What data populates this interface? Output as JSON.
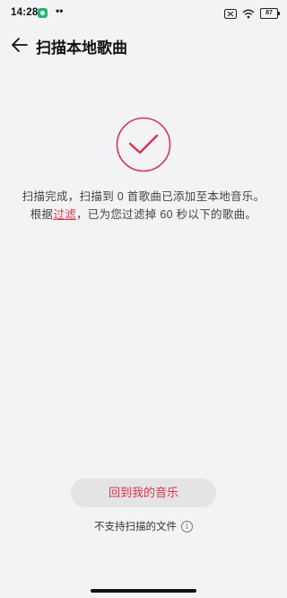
{
  "status_bar": {
    "time": "14:28",
    "dots": "••",
    "battery": "87",
    "icons": [
      "app-notification-icon",
      "sim-off-icon",
      "wifi-icon",
      "battery-icon"
    ]
  },
  "header": {
    "back_icon": "back-arrow-icon",
    "title": "扫描本地歌曲"
  },
  "result": {
    "icon": "check-circle-icon",
    "accent_color": "#d9344d",
    "line1": "扫描完成，扫描到 0 首歌曲已添加至本地音乐。",
    "line2_prefix": "根据",
    "line2_link": "过滤",
    "line2_suffix": "，已为您过滤掉 60 秒以下的歌曲。"
  },
  "actions": {
    "primary_button": "回到我的音乐",
    "unsupported_label": "不支持扫描的文件",
    "info_icon": "info-icon",
    "info_glyph": "i"
  }
}
